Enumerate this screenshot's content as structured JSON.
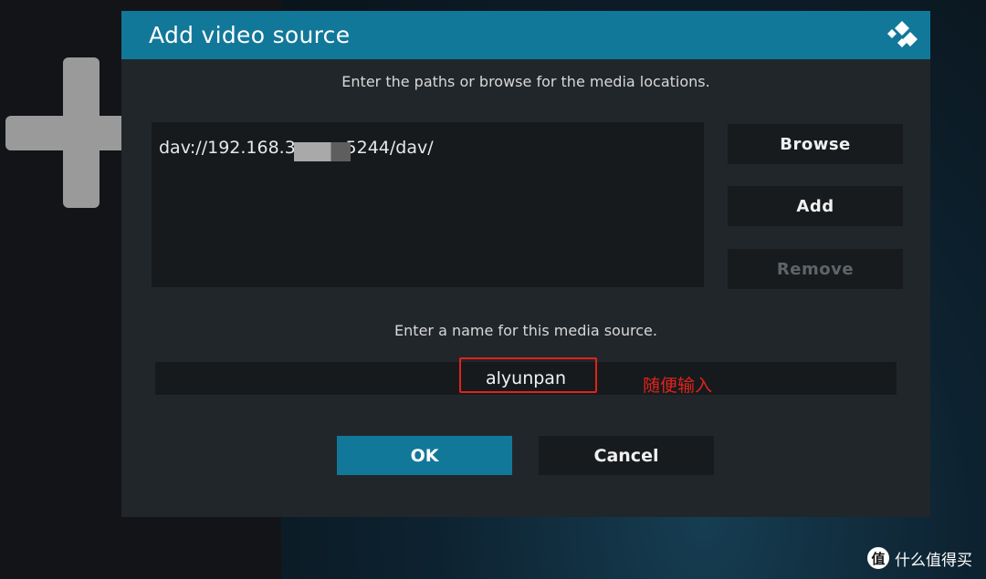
{
  "dialog": {
    "title": "Add video source",
    "paths_prompt": "Enter the paths or browse for the media locations.",
    "paths": [
      "dav://192.168.3        :5244/dav/"
    ],
    "buttons": {
      "browse": "Browse",
      "add": "Add",
      "remove": "Remove"
    },
    "name_prompt": "Enter a name for this media source.",
    "name_value": "alyunpan",
    "ok": "OK",
    "cancel": "Cancel"
  },
  "annotation": {
    "text": "随便输入",
    "color": "#e0231c"
  },
  "watermark": {
    "logo_char": "值",
    "text": "什么值得买"
  },
  "colors": {
    "accent": "#12789a",
    "dialog_bg": "#21262a",
    "field_bg": "#161a1d",
    "disabled_text": "#5f6468"
  },
  "icons": {
    "background": "plus-icon",
    "dialog_logo": "kodi-logo-icon"
  }
}
